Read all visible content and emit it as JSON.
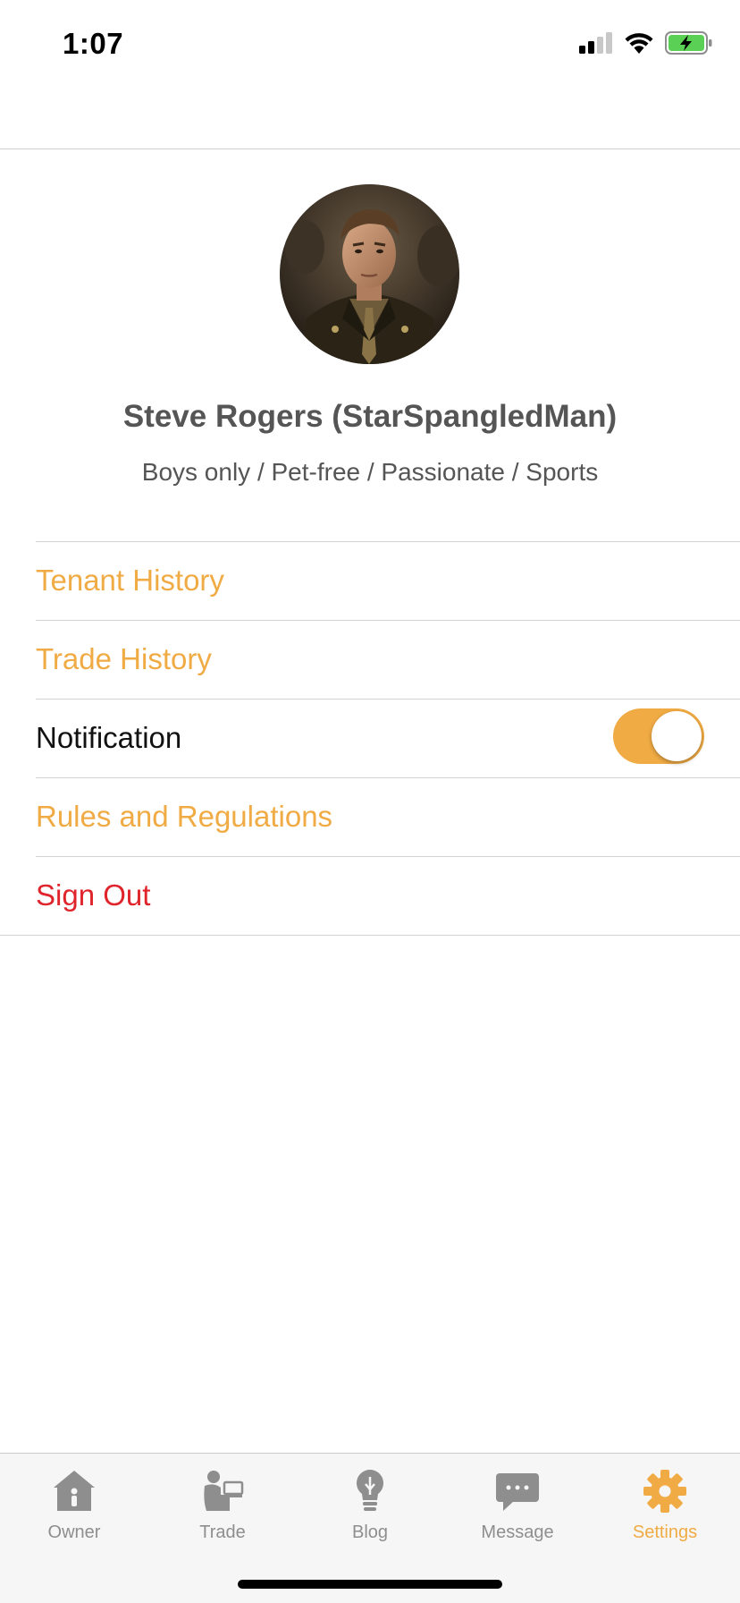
{
  "status_bar": {
    "time": "1:07",
    "icons": [
      "cellular-signal-icon",
      "wifi-icon",
      "battery-charging-icon"
    ],
    "battery_color": "#5ad154"
  },
  "profile": {
    "avatar_icon": "profile-photo",
    "name": "Steve Rogers (StarSpangledMan)",
    "tags": "Boys only / Pet-free / Passionate / Sports"
  },
  "settings": {
    "items": [
      {
        "label": "Tenant History"
      },
      {
        "label": "Trade History"
      },
      {
        "label": "Notification",
        "toggle_on": true
      },
      {
        "label": "Rules and Regulations"
      },
      {
        "label": "Sign Out"
      }
    ]
  },
  "tab_bar": {
    "tabs": [
      {
        "label": "Owner",
        "icon": "house-icon",
        "active": false
      },
      {
        "label": "Trade",
        "icon": "person-at-desk-icon",
        "active": false
      },
      {
        "label": "Blog",
        "icon": "lightbulb-icon",
        "active": false
      },
      {
        "label": "Message",
        "icon": "chat-bubble-icon",
        "active": false
      },
      {
        "label": "Settings",
        "icon": "gear-icon",
        "active": true
      }
    ]
  },
  "colors": {
    "accent": "#f0ab44",
    "danger": "#e0242b",
    "inactive_tab": "#8e8e8e",
    "text_gray": "#555555"
  }
}
